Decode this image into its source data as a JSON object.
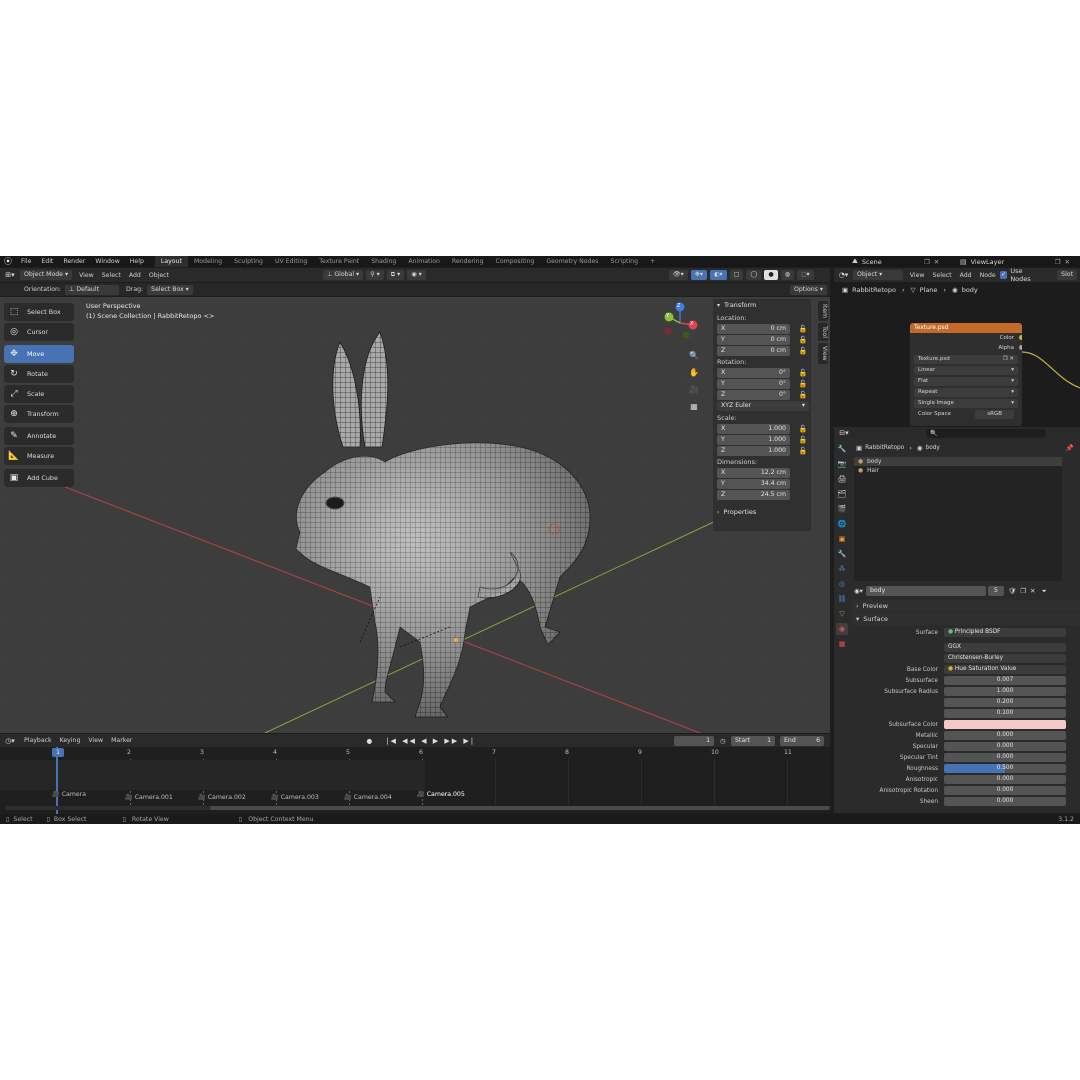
{
  "topbar": {
    "menus": [
      "File",
      "Edit",
      "Render",
      "Window",
      "Help"
    ],
    "workspaces": [
      "Layout",
      "Modeling",
      "Sculpting",
      "UV Editing",
      "Texture Paint",
      "Shading",
      "Animation",
      "Rendering",
      "Compositing",
      "Geometry Nodes",
      "Scripting"
    ],
    "add_workspace": "+",
    "scene": "Scene",
    "view_layer": "ViewLayer"
  },
  "viewport_header": {
    "mode": "Object Mode",
    "menus": [
      "View",
      "Select",
      "Add",
      "Object"
    ],
    "transform_orientation": "Global",
    "orientation_label": "Orientation:",
    "orientation_value": "Default",
    "drag_label": "Drag:",
    "drag_value": "Select Box",
    "options": "Options"
  },
  "viewport": {
    "perspective": "User Perspective",
    "collection": "(1) Scene Collection | RabbitRetopo <>"
  },
  "tools": [
    {
      "label": "Select Box",
      "icon": "select-box-icon",
      "glyph": "⬚",
      "active": false
    },
    {
      "label": "Cursor",
      "icon": "cursor-icon",
      "glyph": "◎",
      "active": false
    },
    {
      "label": "Move",
      "icon": "move-icon",
      "glyph": "✥",
      "active": true
    },
    {
      "label": "Rotate",
      "icon": "rotate-icon",
      "glyph": "↻",
      "active": false
    },
    {
      "label": "Scale",
      "icon": "scale-icon",
      "glyph": "⤢",
      "active": false
    },
    {
      "label": "Transform",
      "icon": "transform-icon",
      "glyph": "⊕",
      "active": false
    },
    {
      "label": "Annotate",
      "icon": "annotate-icon",
      "glyph": "✎",
      "active": false
    },
    {
      "label": "Measure",
      "icon": "measure-icon",
      "glyph": "📐",
      "active": false
    },
    {
      "label": "Add Cube",
      "icon": "add-cube-icon",
      "glyph": "▣",
      "active": false
    }
  ],
  "gizmo": {
    "x": "X",
    "y": "Y",
    "z": "Z"
  },
  "npanel": {
    "transform_title": "Transform",
    "location_label": "Location:",
    "location": [
      {
        "axis": "X",
        "value": "0 cm"
      },
      {
        "axis": "Y",
        "value": "0 cm"
      },
      {
        "axis": "Z",
        "value": "0 cm"
      }
    ],
    "rotation_label": "Rotation:",
    "rotation": [
      {
        "axis": "X",
        "value": "0°"
      },
      {
        "axis": "Y",
        "value": "0°"
      },
      {
        "axis": "Z",
        "value": "0°"
      }
    ],
    "rotation_mode": "XYZ Euler",
    "scale_label": "Scale:",
    "scale": [
      {
        "axis": "X",
        "value": "1.000"
      },
      {
        "axis": "Y",
        "value": "1.000"
      },
      {
        "axis": "Z",
        "value": "1.000"
      }
    ],
    "dimensions_label": "Dimensions:",
    "dimensions": [
      {
        "axis": "X",
        "value": "12.2 cm"
      },
      {
        "axis": "Y",
        "value": "34.4 cm"
      },
      {
        "axis": "Z",
        "value": "24.5 cm"
      }
    ],
    "properties_title": "Properties",
    "tabs": [
      "Item",
      "Tool",
      "View"
    ]
  },
  "timeline": {
    "menus": [
      "Playback",
      "Keying",
      "View",
      "Marker"
    ],
    "current_frame": "1",
    "start_label": "Start",
    "start": "1",
    "end_label": "End",
    "end": "6",
    "frames": [
      "1",
      "2",
      "3",
      "4",
      "5",
      "6",
      "7",
      "8",
      "9",
      "10",
      "11"
    ],
    "cameras": [
      "Camera",
      "Camera.001",
      "Camera.002",
      "Camera.003",
      "Camera.004",
      "Camera.005"
    ]
  },
  "statusbar": {
    "select": "Select",
    "box_select": "Box Select",
    "rotate_view": "Rotate View",
    "context_menu": "Object Context Menu",
    "version": "3.1.2"
  },
  "node_editor": {
    "object_btn": "Object",
    "menus": [
      "View",
      "Select",
      "Add",
      "Node"
    ],
    "use_nodes": "Use Nodes",
    "slot": "Slot",
    "breadcrumb": [
      "RabbitRetopo",
      "Plane",
      "body"
    ],
    "node_title": "Texture.psd",
    "outputs": [
      "Color",
      "Alpha"
    ],
    "image_name": "Texture.psd",
    "fields": [
      "Linear",
      "Flat",
      "Repeat",
      "Single Image"
    ],
    "color_space_label": "Color Space",
    "color_space_value": "sRGB"
  },
  "properties": {
    "breadcrumb": [
      "RabbitRetopo",
      "body"
    ],
    "materials": [
      "body",
      "Hair"
    ],
    "material_name": "body",
    "users": "5",
    "preview": "Preview",
    "surface_section": "Surface",
    "surface_label": "Surface",
    "surface_value": "Principled BSDF",
    "distribution": "GGX",
    "subsurface_method": "Christensen-Burley",
    "base_color_label": "Base Color",
    "base_color_value": "Hue Saturation Value",
    "rows": [
      {
        "label": "Subsurface",
        "value": "0.007"
      },
      {
        "label": "Subsurface Radius",
        "value": "1.000"
      },
      {
        "label": "",
        "value": "0.200"
      },
      {
        "label": "",
        "value": "0.100"
      },
      {
        "label": "Subsurface Color",
        "value": ""
      },
      {
        "label": "Metallic",
        "value": "0.000"
      },
      {
        "label": "Specular",
        "value": "0.000"
      },
      {
        "label": "Specular Tint",
        "value": "0.000"
      },
      {
        "label": "Roughness",
        "value": "0.500"
      },
      {
        "label": "Anisotropic",
        "value": "0.000"
      },
      {
        "label": "Anisotropic Rotation",
        "value": "0.000"
      },
      {
        "label": "Sheen",
        "value": "0.000"
      }
    ],
    "roughness_fill": 0.5,
    "subsurface_color": "#f2c9c4"
  },
  "colors": {
    "accent": "#4772b3",
    "x_axis": "#e0434f",
    "y_axis": "#8bbf3c",
    "z_axis": "#3e7fe0",
    "node_header": "#c3692a",
    "wire": "#c7b43c"
  }
}
